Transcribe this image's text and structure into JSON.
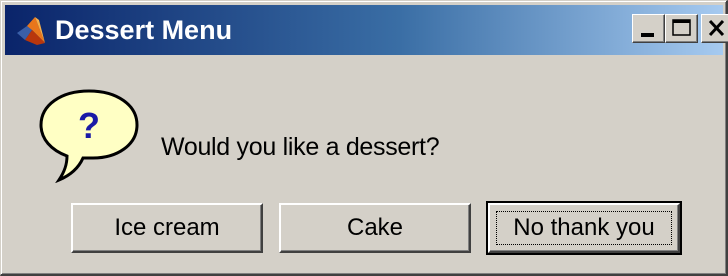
{
  "window": {
    "title": "Dessert Menu",
    "icon": "matlab-logo-icon"
  },
  "caption_buttons": {
    "minimize": "minimize-icon",
    "maximize": "maximize-icon",
    "close": "close-icon"
  },
  "dialog": {
    "icon": "question-bubble-icon",
    "icon_glyph": "?",
    "message": "Would you like a dessert?"
  },
  "buttons": [
    {
      "label": "Ice cream"
    },
    {
      "label": "Cake"
    },
    {
      "label": "No thank you",
      "default": true
    }
  ],
  "colors": {
    "title_gradient_start": "#0a246a",
    "title_gradient_end": "#a6caf0",
    "face": "#d4d0c8",
    "bubble_fill": "#ffffc4",
    "question_mark": "#1a1aa6"
  }
}
